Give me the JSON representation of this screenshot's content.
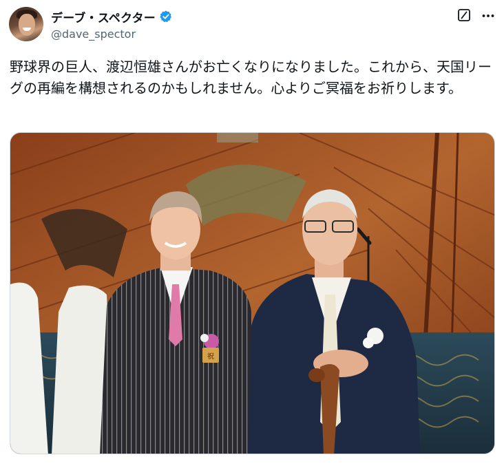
{
  "author": {
    "display_name": "デーブ・スペクター",
    "handle": "@dave_spector",
    "verified": true,
    "avatar_icon": "profile-photo"
  },
  "tweet": {
    "text": "野球界の巨人、渡辺恒雄さんがお亡くなりになりました。これから、天国リーグの再編を構想されるのかもしれません。心よりご冥福をお祈りします。"
  },
  "actions": {
    "grok_icon": "grok-icon",
    "more_icon": "more-icon"
  },
  "media": {
    "type": "photo",
    "badge_text": "祝"
  },
  "colors": {
    "verified_blue": "#1d9bf0",
    "handle_gray": "#536471",
    "text": "#0f1419"
  }
}
